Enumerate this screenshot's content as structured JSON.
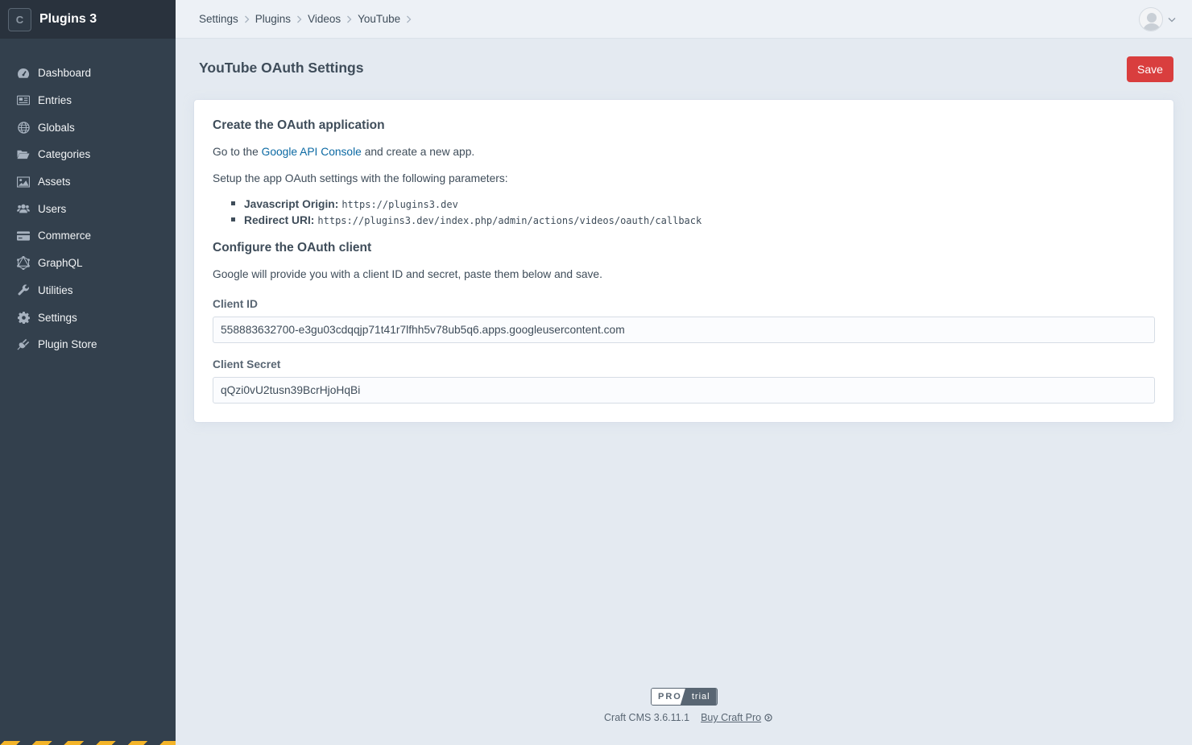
{
  "site": {
    "logo_letter": "C",
    "name": "Plugins 3"
  },
  "nav": [
    {
      "label": "Dashboard",
      "icon": "gauge-icon"
    },
    {
      "label": "Entries",
      "icon": "newspaper-icon"
    },
    {
      "label": "Globals",
      "icon": "globe-icon"
    },
    {
      "label": "Categories",
      "icon": "folder-open-icon"
    },
    {
      "label": "Assets",
      "icon": "image-icon"
    },
    {
      "label": "Users",
      "icon": "users-icon"
    },
    {
      "label": "Commerce",
      "icon": "credit-card-icon"
    },
    {
      "label": "GraphQL",
      "icon": "graphql-icon"
    },
    {
      "label": "Utilities",
      "icon": "wrench-icon"
    },
    {
      "label": "Settings",
      "icon": "gear-icon"
    },
    {
      "label": "Plugin Store",
      "icon": "plug-icon"
    }
  ],
  "breadcrumbs": [
    "Settings",
    "Plugins",
    "Videos",
    "YouTube"
  ],
  "page": {
    "title": "YouTube OAuth Settings",
    "save_label": "Save"
  },
  "card": {
    "section1_title": "Create the OAuth application",
    "goto_prefix": "Go to the ",
    "goto_link": "Google API Console",
    "goto_suffix": " and create a new app.",
    "setup_text": "Setup the app OAuth settings with the following parameters:",
    "origin_label": "Javascript Origin:",
    "origin_value": "https://plugins3.dev",
    "redirect_label": "Redirect URI:",
    "redirect_value": "https://plugins3.dev/index.php/admin/actions/videos/oauth/callback",
    "section2_title": "Configure the OAuth client",
    "client_text": "Google will provide you with a client ID and secret, paste them below and save.",
    "client_id_label": "Client ID",
    "client_id_value": "558883632700-e3gu03cdqqjp71t41r7lfhh5v78ub5q6.apps.googleusercontent.com",
    "client_secret_label": "Client Secret",
    "client_secret_value": "qQzi0vU2tusn39BcrHjoHqBi"
  },
  "footer": {
    "edition_pro": "PRO",
    "edition_trial": "trial",
    "version": "Craft CMS 3.6.11.1",
    "buy_label": "Buy Craft Pro"
  },
  "colors": {
    "sidebar": "#33404d",
    "accent_red": "#d93e3e",
    "link": "#0b69a3",
    "page_bg": "#e4eaf1"
  }
}
